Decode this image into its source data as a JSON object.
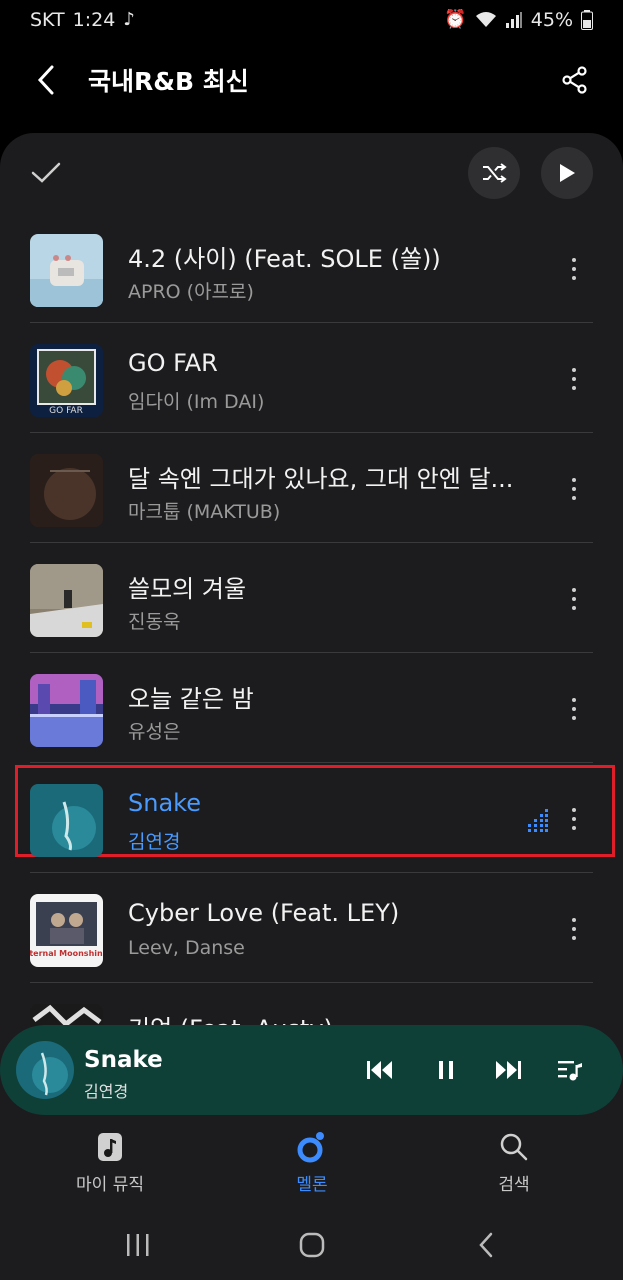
{
  "status_bar": {
    "carrier": "SKT",
    "time": "1:24",
    "battery": "45%"
  },
  "header": {
    "title": "국내R&B 최신"
  },
  "tracks": [
    {
      "title": "4.2 (사이) (Feat. SOLE (쏠))",
      "artist": "APRO (아프로)"
    },
    {
      "title": "GO FAR",
      "artist": "임다이 (Im DAI)"
    },
    {
      "title": "달 속엔 그대가 있나요, 그대 안엔 달...",
      "artist": "마크툽 (MAKTUB)"
    },
    {
      "title": "쓸모의 겨울",
      "artist": "진동욱"
    },
    {
      "title": "오늘 같은 밤",
      "artist": "유성은"
    },
    {
      "title": "Snake",
      "artist": "김연경",
      "playing": true
    },
    {
      "title": "Cyber Love (Feat. LEY)",
      "artist": "Leev, Danse"
    },
    {
      "title": "기억 (Feat. Austy)",
      "artist": ""
    }
  ],
  "album_art_text": {
    "go_far": "GO FAR",
    "eternal": "Eternal Moonshine"
  },
  "mini_player": {
    "title": "Snake",
    "artist": "김연경"
  },
  "bottom_nav": [
    {
      "label": "마이 뮤직"
    },
    {
      "label": "멜론"
    },
    {
      "label": "검색"
    }
  ],
  "colors": {
    "accent": "#3c8cff",
    "mini_player_bg": "#0f4038",
    "highlight": "#e01e2a"
  }
}
